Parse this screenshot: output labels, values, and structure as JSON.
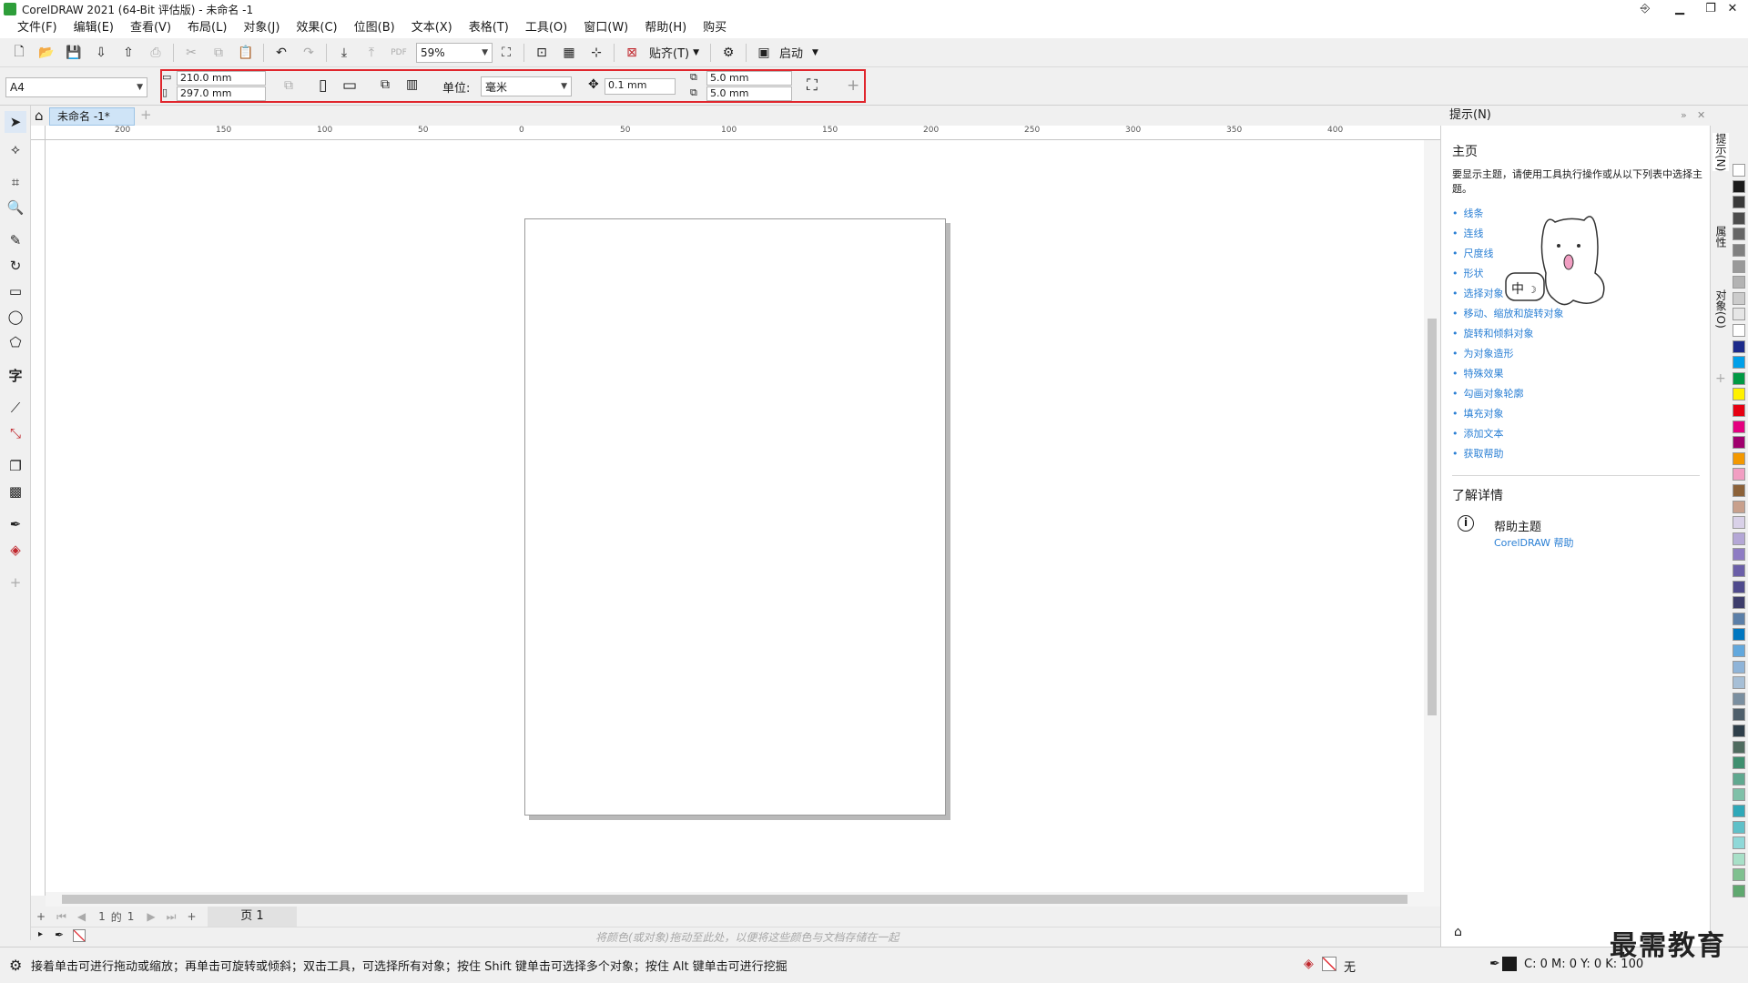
{
  "window": {
    "title": "CorelDRAW 2021 (64-Bit 评估版) - 未命名 -1",
    "controls": [
      "▁",
      "❐",
      "✕"
    ]
  },
  "menu": [
    "文件(F)",
    "编辑(E)",
    "查看(V)",
    "布局(L)",
    "对象(J)",
    "效果(C)",
    "位图(B)",
    "文本(X)",
    "表格(T)",
    "工具(O)",
    "窗口(W)",
    "帮助(H)",
    "购买"
  ],
  "toolbar": {
    "zoom": "59%",
    "snap_label": "贴齐(T)",
    "launch_label": "启动"
  },
  "propbar": {
    "page_size": "A4",
    "width": "210.0 mm",
    "height": "297.0 mm",
    "unit_label": "单位:",
    "unit_value": "毫米",
    "nudge": "0.1 mm",
    "dup_x": "5.0 mm",
    "dup_y": "5.0 mm"
  },
  "tabs": {
    "doc_tab": "未命名 -1*"
  },
  "ruler": {
    "h_labels": [
      "200",
      "150",
      "100",
      "50",
      "0",
      "50",
      "100",
      "150",
      "200",
      "250",
      "300",
      "350",
      "400"
    ]
  },
  "pagenav": {
    "current": "1",
    "of": "的",
    "total": "1",
    "page_tab": "页 1"
  },
  "docpalette": {
    "hint": "将颜色(或对象)拖动至此处，以便将这些颜色与文档存储在一起"
  },
  "status": {
    "message": "接着单击可进行拖动或缩放；再单击可旋转或倾斜；双击工具，可选择所有对象；按住 Shift 键单击可选择多个对象；按住 Alt 键单击可进行挖掘",
    "fill_label": "无",
    "cmyk": "C: 0 M: 0 Y: 0 K: 100"
  },
  "docker": {
    "header": "提示(N)",
    "home_title": "主页",
    "description": "要显示主题，请使用工具执行操作或从以下列表中选择主题。",
    "topics": [
      "线条",
      "连线",
      "尺度线",
      "形状",
      "选择对象",
      "移动、缩放和旋转对象",
      "旋转和倾斜对象",
      "为对象造形",
      "特殊效果",
      "勾画对象轮廓",
      "填充对象",
      "添加文本",
      "获取帮助"
    ],
    "learn_more": "了解详情",
    "help_topics": "帮助主题",
    "help_link": "CorelDRAW 帮助"
  },
  "side_tabs": [
    "提示(N)",
    "属性",
    "对象(O)"
  ],
  "sticker_text": "中",
  "watermark": "最需教育",
  "colors": {
    "accent": "#2a7fd4",
    "highlight": "#e0262d",
    "palette": [
      "#ffffff",
      "#1a1a1a",
      "#3a3a3a",
      "#4d4d4d",
      "#666666",
      "#808080",
      "#999999",
      "#b3b3b3",
      "#cccccc",
      "#e6e6e6",
      "#ffffff",
      "#1c2a8a",
      "#00a0e9",
      "#009944",
      "#fff100",
      "#e60012",
      "#e4007f",
      "#a0006e",
      "#f39800",
      "#f19ec2",
      "#8c6239",
      "#c8a08c",
      "#d9d1e8",
      "#b4a7d6",
      "#8e7cc3",
      "#6b5fa8",
      "#4f4a8c",
      "#3d3d6b",
      "#5b7fa8",
      "#0077c0",
      "#62a8dd",
      "#8fb4d8",
      "#a7bfd6",
      "#7a8fa0",
      "#4f5f6b",
      "#2f3f4a",
      "#4f6b5f",
      "#3f8f6f",
      "#5fa88f",
      "#7fc0a8",
      "#2fa8b8",
      "#5fc0c8",
      "#8fd8d8",
      "#a8e0c8",
      "#7fc08f",
      "#5fa86f"
    ]
  }
}
